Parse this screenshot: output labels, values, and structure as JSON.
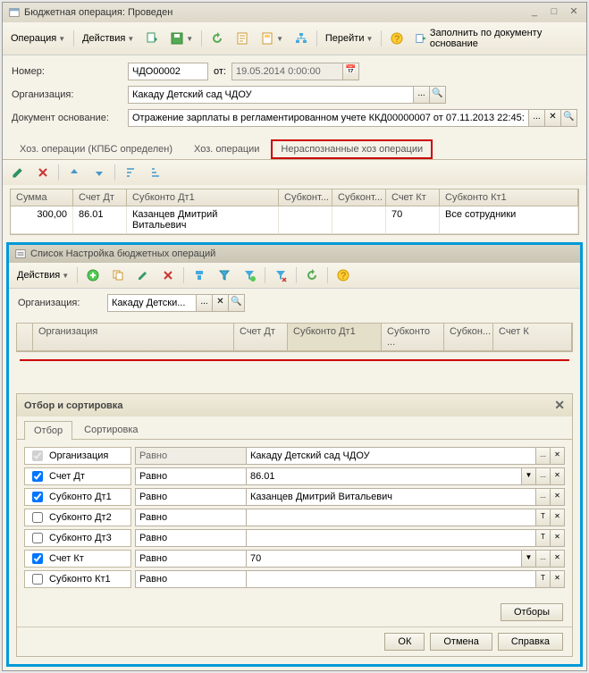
{
  "window": {
    "title": "Бюджетная операция: Проведен"
  },
  "toolbar": {
    "operation": "Операция",
    "actions": "Действия",
    "goto": "Перейти",
    "fill_by_doc": "Заполнить по документу основание"
  },
  "form": {
    "number_label": "Номер:",
    "number_value": "ЧДО00002",
    "from_label": "от:",
    "date_value": "19.05.2014 0:00:00",
    "org_label": "Организация:",
    "org_value": "Какаду Детский сад ЧДОУ",
    "docbase_label": "Документ основание:",
    "docbase_value": "Отражение зарплаты в регламентированном учете ККД00000007 от 07.11.2013 22:45:00"
  },
  "tabs": {
    "t1": "Хоз. операции (КПБС определен)",
    "t2": "Хоз. операции",
    "t3": "Нераспознанные хоз операции"
  },
  "grid": {
    "headers": {
      "sum": "Сумма",
      "acct_dt": "Счет Дт",
      "sub_dt1": "Субконто Дт1",
      "sub_dt2": "Субконт...",
      "sub_dt3": "Субконт...",
      "acct_kt": "Счет Кт",
      "sub_kt1": "Субконто Кт1"
    },
    "row": {
      "sum": "300,00",
      "acct_dt": "86.01",
      "sub_dt1": "Казанцев Дмитрий Витальевич",
      "sub_dt2": "",
      "sub_dt3": "",
      "acct_kt": "70",
      "sub_kt1": "Все сотрудники"
    }
  },
  "subwindow": {
    "title": "Список Настройка бюджетных операций",
    "actions": "Действия",
    "org_label": "Организация:",
    "org_value": "Какаду Детски...",
    "grid_headers": {
      "org": "Организация",
      "acct_dt": "Счет Дт",
      "sub_dt1": "Субконто Дт1",
      "sub_dt2": "Субконто ...",
      "sub_dt3": "Субкон...",
      "acct_kt": "Счет К"
    }
  },
  "filter": {
    "title": "Отбор и сортировка",
    "tab_filter": "Отбор",
    "tab_sort": "Сортировка",
    "cond_equals": "Равно",
    "rows": {
      "org": {
        "label": "Организация",
        "value": "Какаду Детский сад ЧДОУ"
      },
      "acct_dt": {
        "label": "Счет Дт",
        "value": "86.01"
      },
      "sub_dt1": {
        "label": "Субконто Дт1",
        "value": "Казанцев Дмитрий Витальевич"
      },
      "sub_dt2": {
        "label": "Субконто Дт2",
        "value": ""
      },
      "sub_dt3": {
        "label": "Субконто Дт3",
        "value": ""
      },
      "acct_kt": {
        "label": "Счет Кт",
        "value": "70"
      },
      "sub_kt1": {
        "label": "Субконто Кт1",
        "value": ""
      }
    },
    "btn_filters": "Отборы",
    "btn_ok": "ОК",
    "btn_cancel": "Отмена",
    "btn_help": "Справка"
  }
}
